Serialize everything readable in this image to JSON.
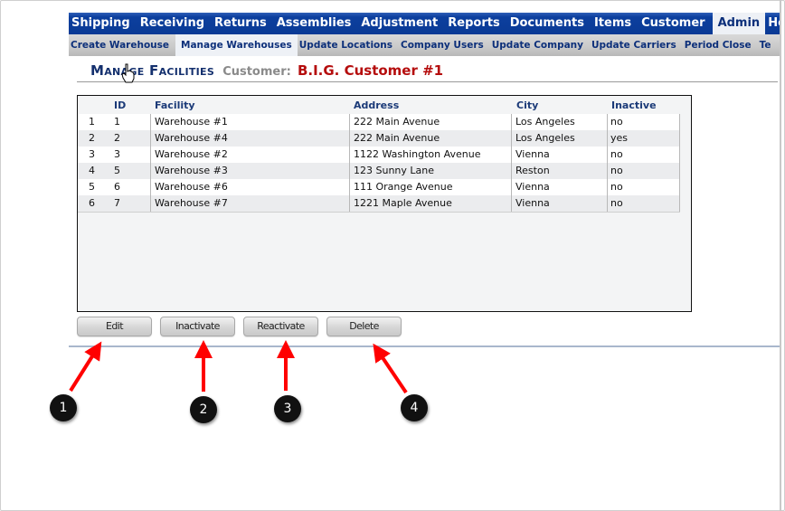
{
  "top_nav": {
    "tabs": [
      "Shipping",
      "Receiving",
      "Returns",
      "Assemblies",
      "Adjustment",
      "Reports",
      "Documents",
      "Items",
      "Customer",
      "Admin",
      "Home"
    ],
    "active": "Admin"
  },
  "sub_nav": {
    "tabs": [
      "Create Warehouse",
      "Manage Warehouses",
      "Update Locations",
      "Company Users",
      "Update Company",
      "Update Carriers",
      "Period Close",
      "Te"
    ],
    "active": "Manage Warehouses"
  },
  "page": {
    "title": "Manage Facilities",
    "customer_label": "Customer:",
    "customer_name": "B.I.G. Customer #1"
  },
  "grid": {
    "columns": [
      "",
      "ID",
      "Facility",
      "Address",
      "City",
      "Inactive"
    ],
    "rows": [
      {
        "row": "1",
        "id": "1",
        "facility": "Warehouse #1",
        "address": "222 Main Avenue",
        "city": "Los Angeles",
        "inactive": "no"
      },
      {
        "row": "2",
        "id": "2",
        "facility": "Warehouse #4",
        "address": "222 Main Avenue",
        "city": "Los Angeles",
        "inactive": "yes"
      },
      {
        "row": "3",
        "id": "3",
        "facility": "Warehouse #2",
        "address": "1122 Washington Avenue",
        "city": "Vienna",
        "inactive": "no"
      },
      {
        "row": "4",
        "id": "5",
        "facility": "Warehouse #3",
        "address": "123 Sunny Lane",
        "city": "Reston",
        "inactive": "no"
      },
      {
        "row": "5",
        "id": "6",
        "facility": "Warehouse #6",
        "address": "111 Orange Avenue",
        "city": "Vienna",
        "inactive": "no"
      },
      {
        "row": "6",
        "id": "7",
        "facility": "Warehouse #7",
        "address": "1221 Maple Avenue",
        "city": "Vienna",
        "inactive": "no"
      }
    ]
  },
  "buttons": {
    "edit": "Edit",
    "inactivate": "Inactivate",
    "reactivate": "Reactivate",
    "delete": "Delete"
  },
  "callouts": [
    "1",
    "2",
    "3",
    "4"
  ],
  "colors": {
    "nav_blue": "#0a3a95",
    "title_navy": "#14306e",
    "customer_red": "#b50d0d",
    "arrow_red": "#ff0000"
  }
}
